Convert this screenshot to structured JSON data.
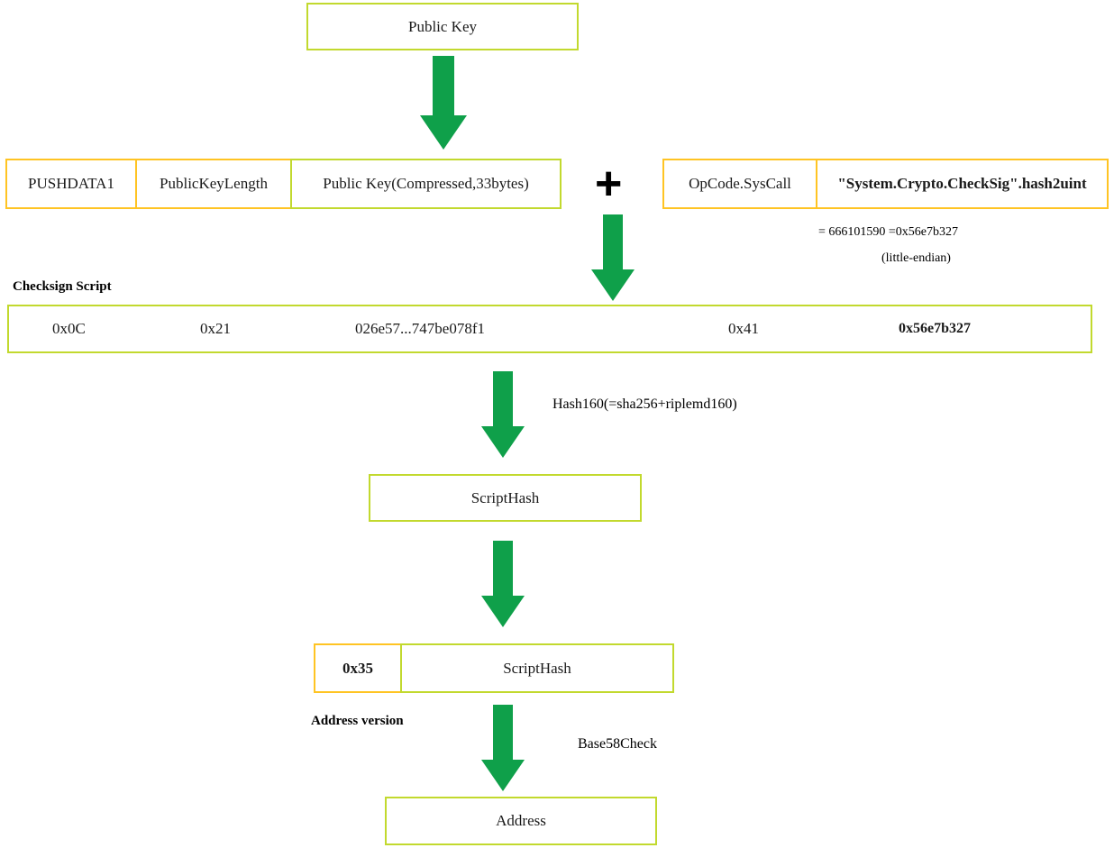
{
  "title": "NEO address derivation from public key",
  "colors": {
    "arrow_green": "#0fa04a",
    "border_green": "#c2d92e",
    "border_orange": "#ffc423",
    "text": "#1a1a1a",
    "background": "#ffffff"
  },
  "nodes": {
    "public_key": {
      "label": "Public Key"
    },
    "script_hash_1": {
      "label": "ScriptHash"
    },
    "script_hash_2": {
      "label": "ScriptHash"
    },
    "address": {
      "label": "Address"
    },
    "address_version": {
      "label": "0x35"
    }
  },
  "pubkey_row": {
    "cells": [
      {
        "label": "PUSHDATA1",
        "border": "orange"
      },
      {
        "label": "PublicKeyLength",
        "border": "orange"
      },
      {
        "label": "Public Key(Compressed,33bytes)",
        "border": "green"
      }
    ]
  },
  "operator": {
    "plus": "+"
  },
  "syscall_row": {
    "cells": [
      {
        "label": "OpCode.SysCall",
        "border": "orange"
      },
      {
        "label": "\"System.Crypto.CheckSig\".hash2uint",
        "border": "orange",
        "bold": true
      }
    ],
    "annotations": [
      "= 666101590 =0x56e7b327",
      "(little-endian)"
    ]
  },
  "checksign_script": {
    "caption": "Checksign Script",
    "fields": [
      {
        "label": "0x0C",
        "bold": false
      },
      {
        "label": "0x21",
        "bold": false
      },
      {
        "label": "026e57...747be078f1",
        "bold": false
      },
      {
        "label": "0x41",
        "bold": false
      },
      {
        "label": "0x56e7b327",
        "bold": true
      }
    ]
  },
  "edge_labels": {
    "hash160": "Hash160(=sha256+riplemd160)",
    "address_version": "Address version",
    "base58check": "Base58Check"
  },
  "icons": {
    "down_arrow": "down-arrow-icon",
    "plus": "plus-icon"
  }
}
